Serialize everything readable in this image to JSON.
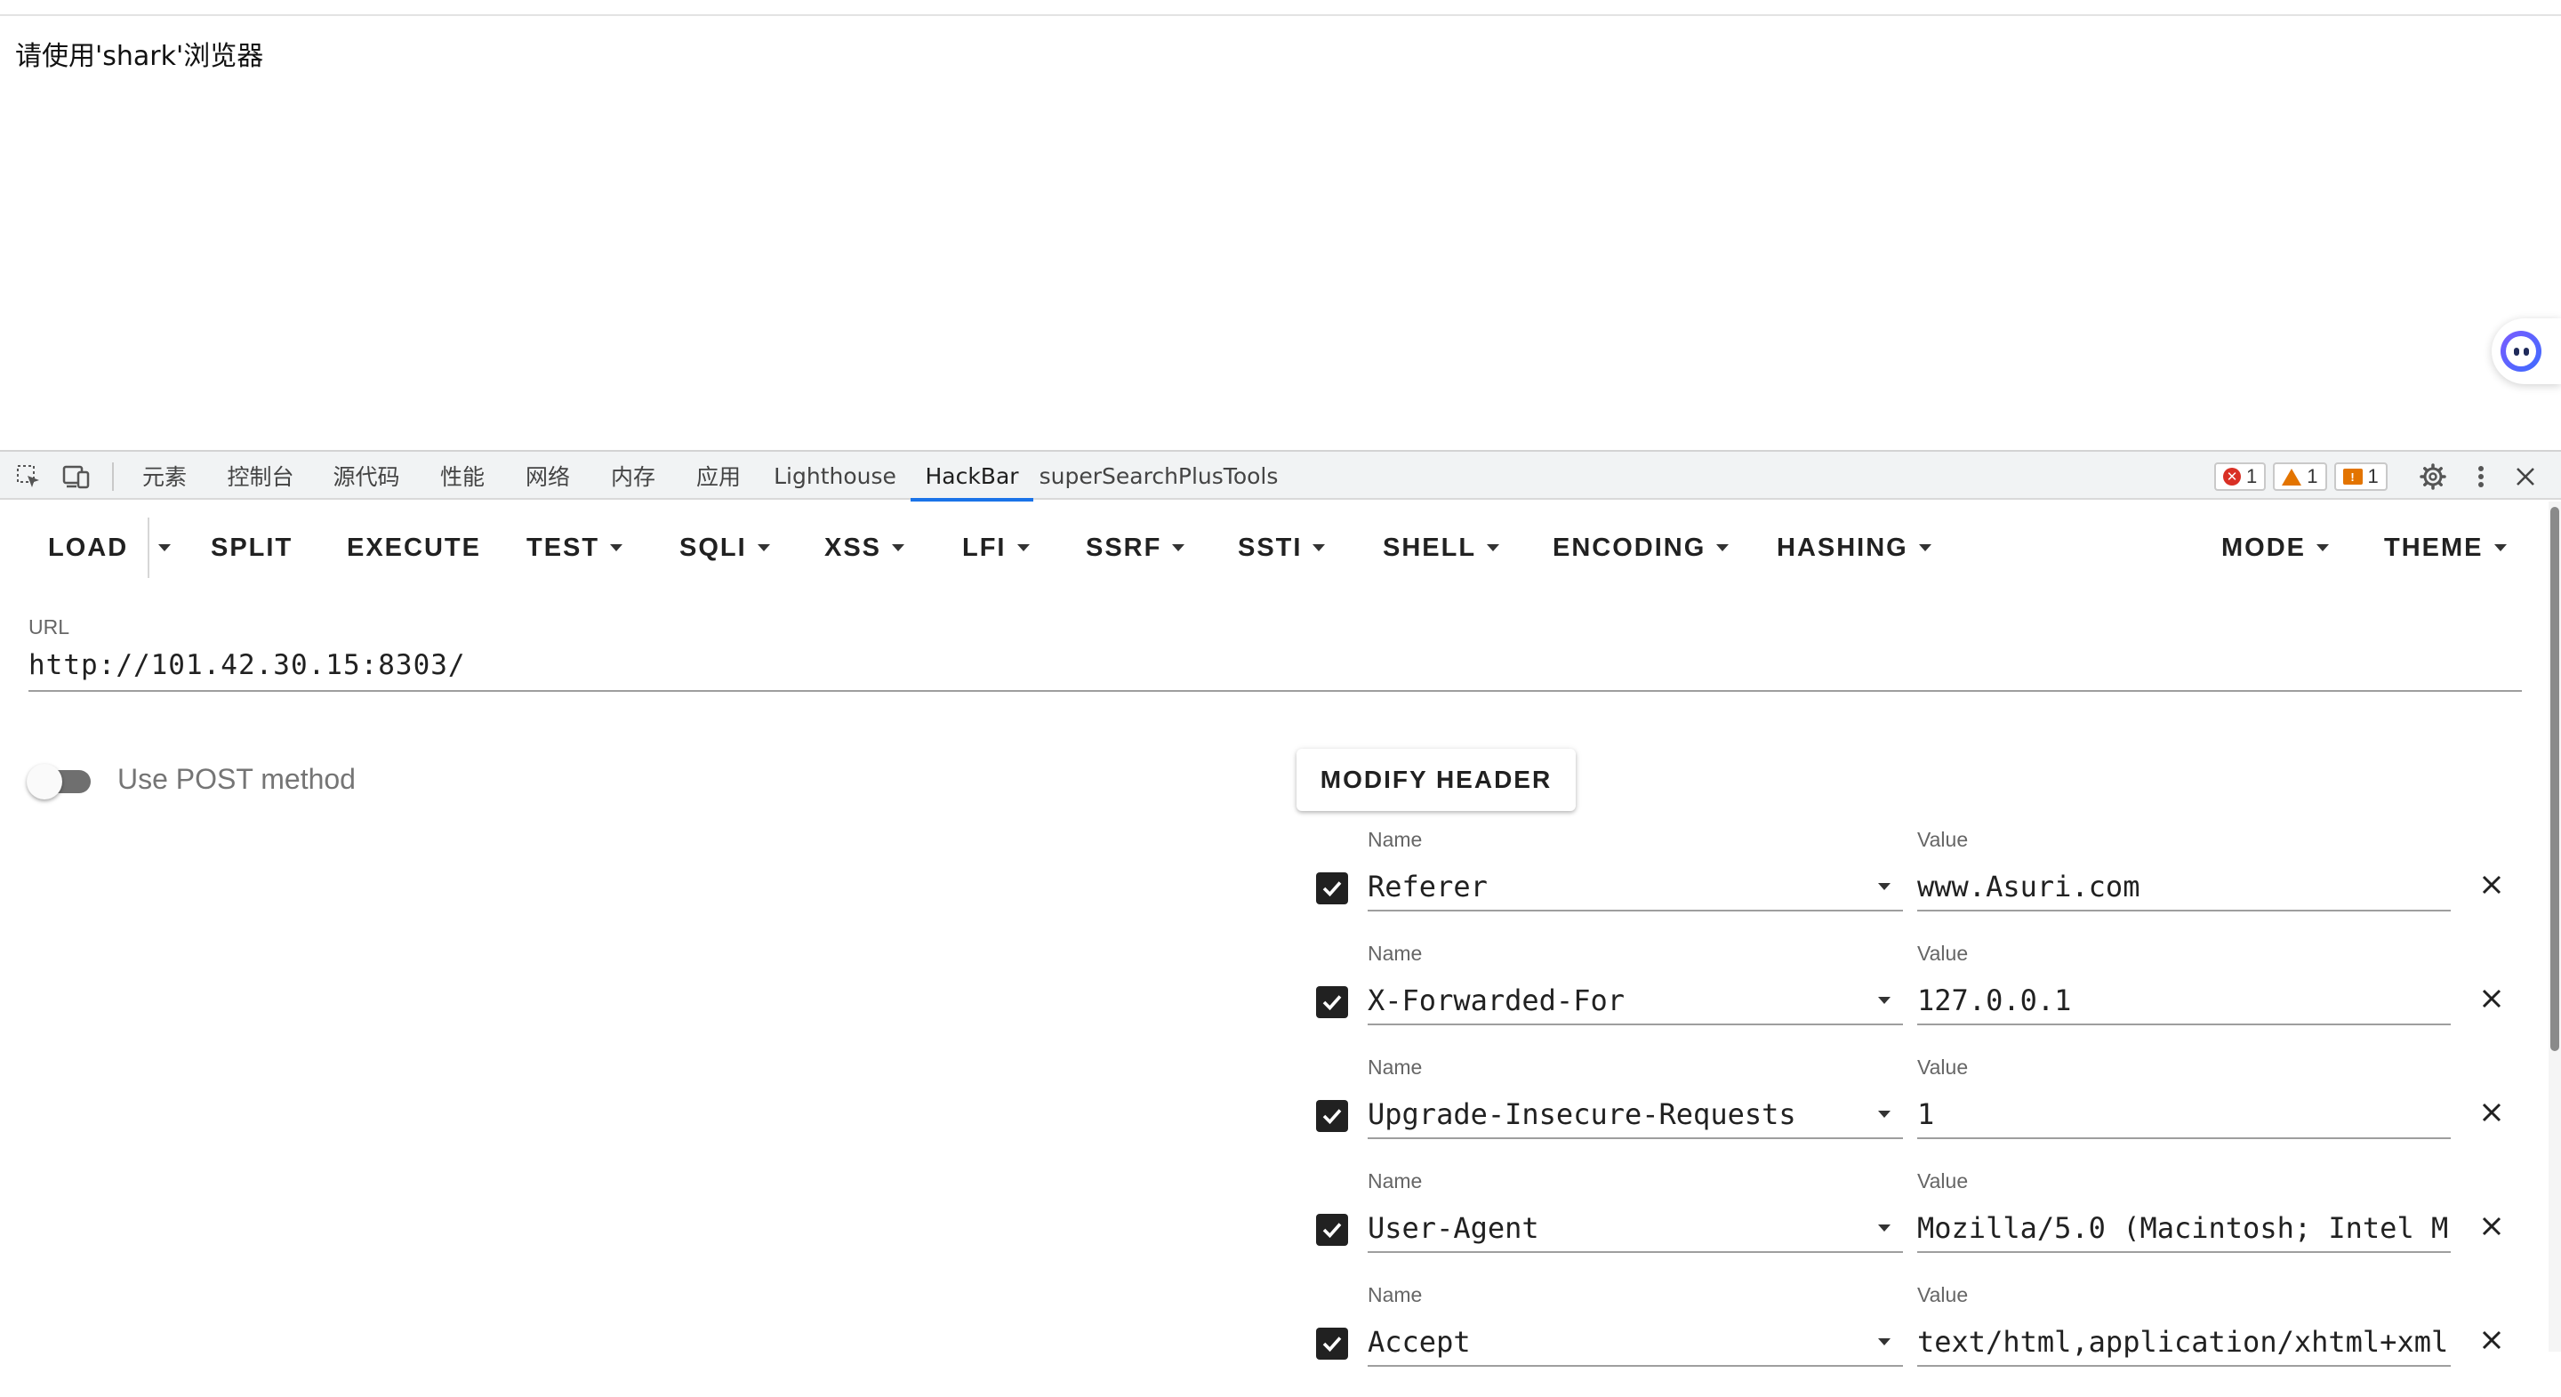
{
  "page": {
    "message": "请使用'shark'浏览器"
  },
  "devtools": {
    "tabs": [
      "元素",
      "控制台",
      "源代码",
      "性能",
      "网络",
      "内存",
      "应用",
      "Lighthouse",
      "HackBar",
      "superSearchPlusTools"
    ],
    "active_tab": "HackBar",
    "badges": {
      "errors": "1",
      "warnings": "1",
      "issues": "1"
    }
  },
  "hackbar": {
    "toolbar": {
      "load": "LOAD",
      "split": "SPLIT",
      "execute": "EXECUTE",
      "test": "TEST",
      "sqli": "SQLI",
      "xss": "XSS",
      "lfi": "LFI",
      "ssrf": "SSRF",
      "ssti": "SSTI",
      "shell": "SHELL",
      "encoding": "ENCODING",
      "hashing": "HASHING",
      "mode": "MODE",
      "theme": "THEME"
    },
    "url_label": "URL",
    "url_value": "http://101.42.30.15:8303/",
    "post_label": "Use POST method",
    "post_enabled": false,
    "modify_header": "MODIFY HEADER",
    "header_name_label": "Name",
    "header_value_label": "Value",
    "headers": [
      {
        "name": "Referer",
        "value": "www.Asuri.com",
        "enabled": true
      },
      {
        "name": "X-Forwarded-For",
        "value": "127.0.0.1",
        "enabled": true
      },
      {
        "name": "Upgrade-Insecure-Requests",
        "value": "1",
        "enabled": true
      },
      {
        "name": "User-Agent",
        "value": "Mozilla/5.0 (Macintosh; Intel M",
        "enabled": true
      },
      {
        "name": "Accept",
        "value": "text/html,application/xhtml+xml",
        "enabled": true
      }
    ]
  },
  "colors": {
    "accent": "#1a73e8",
    "error": "#d93025",
    "warning": "#e37400"
  }
}
